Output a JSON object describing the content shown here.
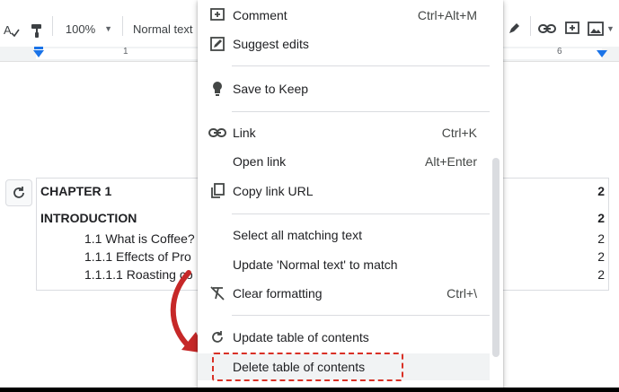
{
  "toolbar": {
    "zoom": "100%",
    "paragraph_style": "Normal text"
  },
  "ruler": {
    "left_number": "1",
    "right_number": "6"
  },
  "toc": {
    "lines": [
      {
        "text": "CHAPTER 1",
        "page": "2"
      },
      {
        "text": "INTRODUCTION",
        "page": "2"
      },
      {
        "text": "1.1 What is Coffee?",
        "page": "2"
      },
      {
        "text": "1.1.1 Effects of Pro",
        "page": "2"
      },
      {
        "text": "1.1.1.1 Roasting co",
        "page": "2"
      }
    ]
  },
  "context_menu": {
    "items": [
      {
        "label": "Comment",
        "shortcut": "Ctrl+Alt+M",
        "icon": "add-comment-icon"
      },
      {
        "label": "Suggest edits",
        "shortcut": "",
        "icon": "suggest-edits-icon"
      },
      {
        "label": "Save to Keep",
        "shortcut": "",
        "icon": "lightbulb-icon"
      },
      {
        "label": "Link",
        "shortcut": "Ctrl+K",
        "icon": "link-icon"
      },
      {
        "label": "Open link",
        "shortcut": "Alt+Enter",
        "icon": ""
      },
      {
        "label": "Copy link URL",
        "shortcut": "",
        "icon": "copy-icon"
      },
      {
        "label": "Select all matching text",
        "shortcut": "",
        "icon": ""
      },
      {
        "label": "Update 'Normal text' to match",
        "shortcut": "",
        "icon": ""
      },
      {
        "label": "Clear formatting",
        "shortcut": "Ctrl+\\",
        "icon": "clear-formatting-icon"
      },
      {
        "label": "Update table of contents",
        "shortcut": "",
        "icon": "refresh-icon"
      },
      {
        "label": "Delete table of contents",
        "shortcut": "",
        "icon": ""
      }
    ]
  },
  "colors": {
    "accent": "#1a73e8",
    "highlight_border": "#d93025",
    "arrow": "#c62828"
  }
}
